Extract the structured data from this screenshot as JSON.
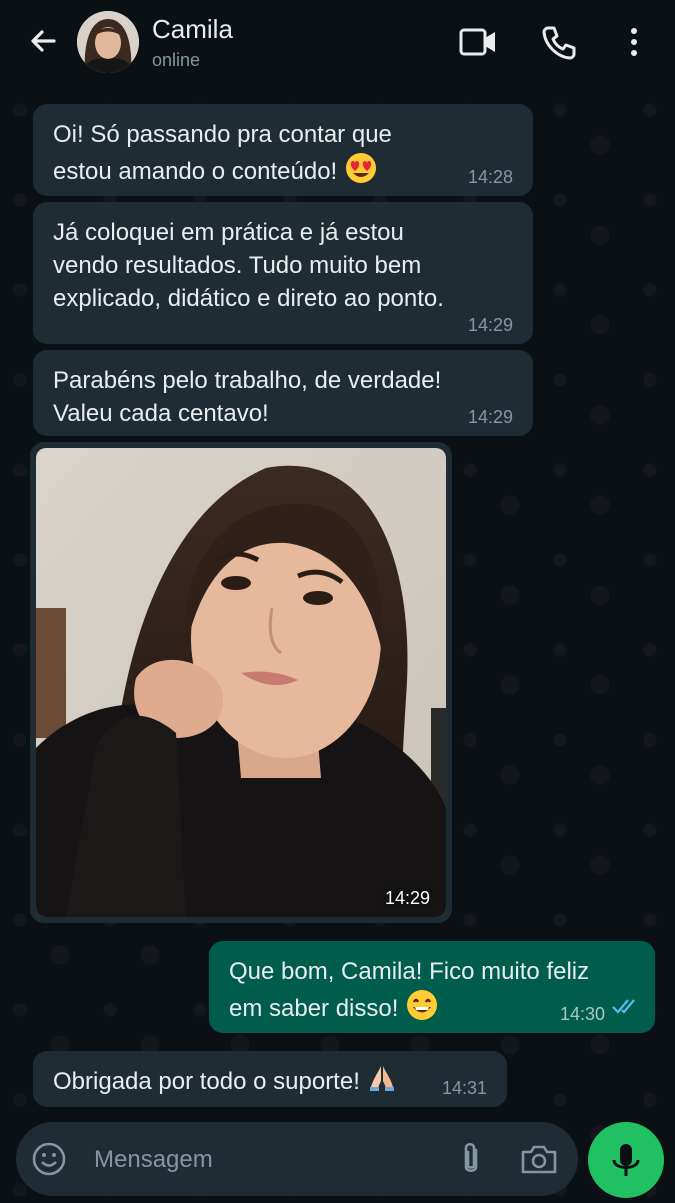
{
  "header": {
    "contact_name": "Camila",
    "status": "online",
    "icons": [
      "back-arrow-icon",
      "video-call-icon",
      "phone-call-icon",
      "more-options-icon"
    ]
  },
  "messages": [
    {
      "direction": "in",
      "text_lines": [
        "Oi! Só passando pra contar que",
        "estou amando o conteúdo!"
      ],
      "emoji": "heart-eyes-emoji",
      "time": "14:28"
    },
    {
      "direction": "in",
      "text_lines": [
        "Já coloquei em prática e já estou",
        "vendo resultados. Tudo muito bem",
        "explicado, didático e direto ao ponto."
      ],
      "time": "14:29"
    },
    {
      "direction": "in",
      "text_lines": [
        "Parabéns pelo trabalho, de verdade!",
        "Valeu cada centavo!"
      ],
      "time": "14:29"
    },
    {
      "direction": "in",
      "type": "image",
      "time": "14:29"
    },
    {
      "direction": "out",
      "text_lines": [
        "Que bom, Camila! Fico muito feliz",
        "em saber disso!"
      ],
      "emoji": "grinning-emoji",
      "time": "14:30",
      "status": "read-double-check-icon"
    },
    {
      "direction": "in",
      "text_lines": [
        "Obrigada por todo o suporte!"
      ],
      "emoji": "folded-hands-emoji",
      "time": "14:31"
    }
  ],
  "input": {
    "placeholder": "Mensagem",
    "value": ""
  },
  "colors": {
    "background": "#0b1014",
    "incoming_bubble": "#202c33",
    "outgoing_bubble": "#005c4b",
    "accent_green": "#21c063",
    "read_tick": "#53bdeb"
  }
}
